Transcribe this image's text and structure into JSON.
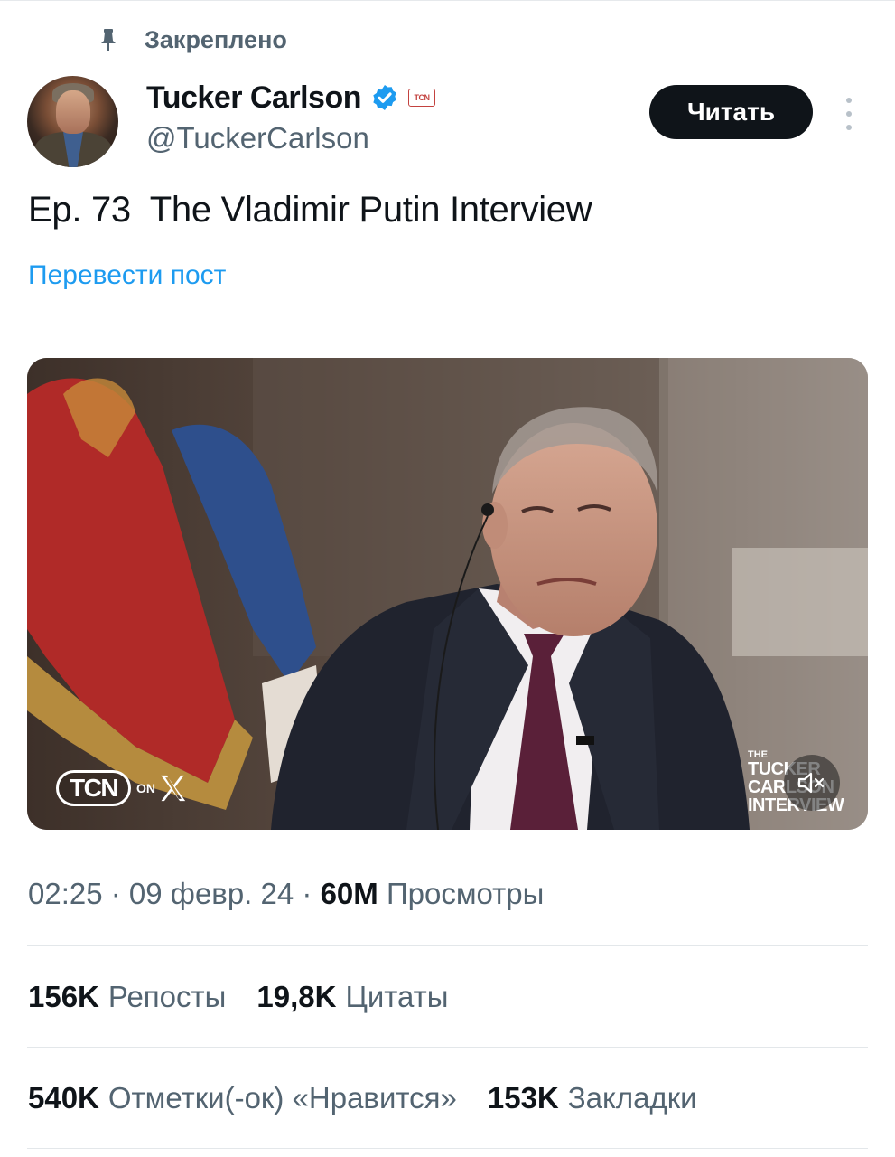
{
  "pinned": {
    "label": "Закреплено",
    "icon": "pin-icon"
  },
  "author": {
    "name": "Tucker Carlson",
    "handle": "@TuckerCarlson",
    "verified_icon": "verified-badge-icon",
    "affiliate_badge": "TCN",
    "follow_label": "Читать",
    "more_icon": "more-vertical-icon"
  },
  "post": {
    "text": "Ep. 73  The Vladimir Putin Interview",
    "translate_label": "Перевести пост"
  },
  "video": {
    "tcn_logo": "TCN",
    "tcn_on": "ON",
    "overlay_small": "THE",
    "overlay_line1": "TUCKER",
    "overlay_line2": "CARLSON",
    "overlay_line3": "INTERVIEW",
    "mute_icon": "speaker-muted-icon"
  },
  "meta": {
    "time": "02:25",
    "sep1": " · ",
    "date": "09 февр. 24",
    "sep2": " · ",
    "views_count": "60M",
    "views_label": "Просмотры"
  },
  "stats": {
    "reposts_count": "156K",
    "reposts_label": "Репосты",
    "quotes_count": "19,8K",
    "quotes_label": "Цитаты",
    "likes_count": "540K",
    "likes_label": "Отметки(-ок) «Нравится»",
    "bookmarks_count": "153K",
    "bookmarks_label": "Закладки"
  },
  "colors": {
    "accent": "#1d9bf0",
    "secondary_text": "#536471",
    "primary_text": "#0f1419",
    "follow_bg": "#0f1419"
  }
}
